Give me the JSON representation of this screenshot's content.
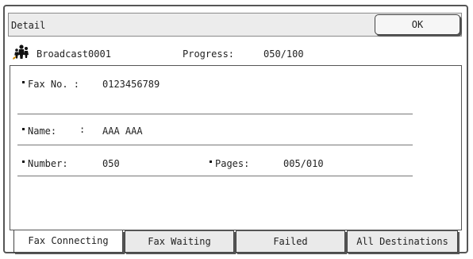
{
  "header": {
    "title": "Detail",
    "ok_label": "OK"
  },
  "job": {
    "name": "Broadcast0001",
    "progress_label": "Progress:",
    "progress_value": "050/100"
  },
  "details": {
    "fax_no_label": "Fax No. :",
    "fax_no_value": "0123456789",
    "name_label": "Name:",
    "name_separator": ":",
    "name_value": "AAA AAA",
    "number_label": "Number:",
    "number_value": "050",
    "pages_label": "Pages:",
    "pages_value": "005/010"
  },
  "tabs": [
    {
      "label": "Fax Connecting",
      "active": true
    },
    {
      "label": "Fax Waiting",
      "active": false
    },
    {
      "label": "Failed",
      "active": false
    },
    {
      "label": "All Destinations",
      "active": false
    }
  ]
}
